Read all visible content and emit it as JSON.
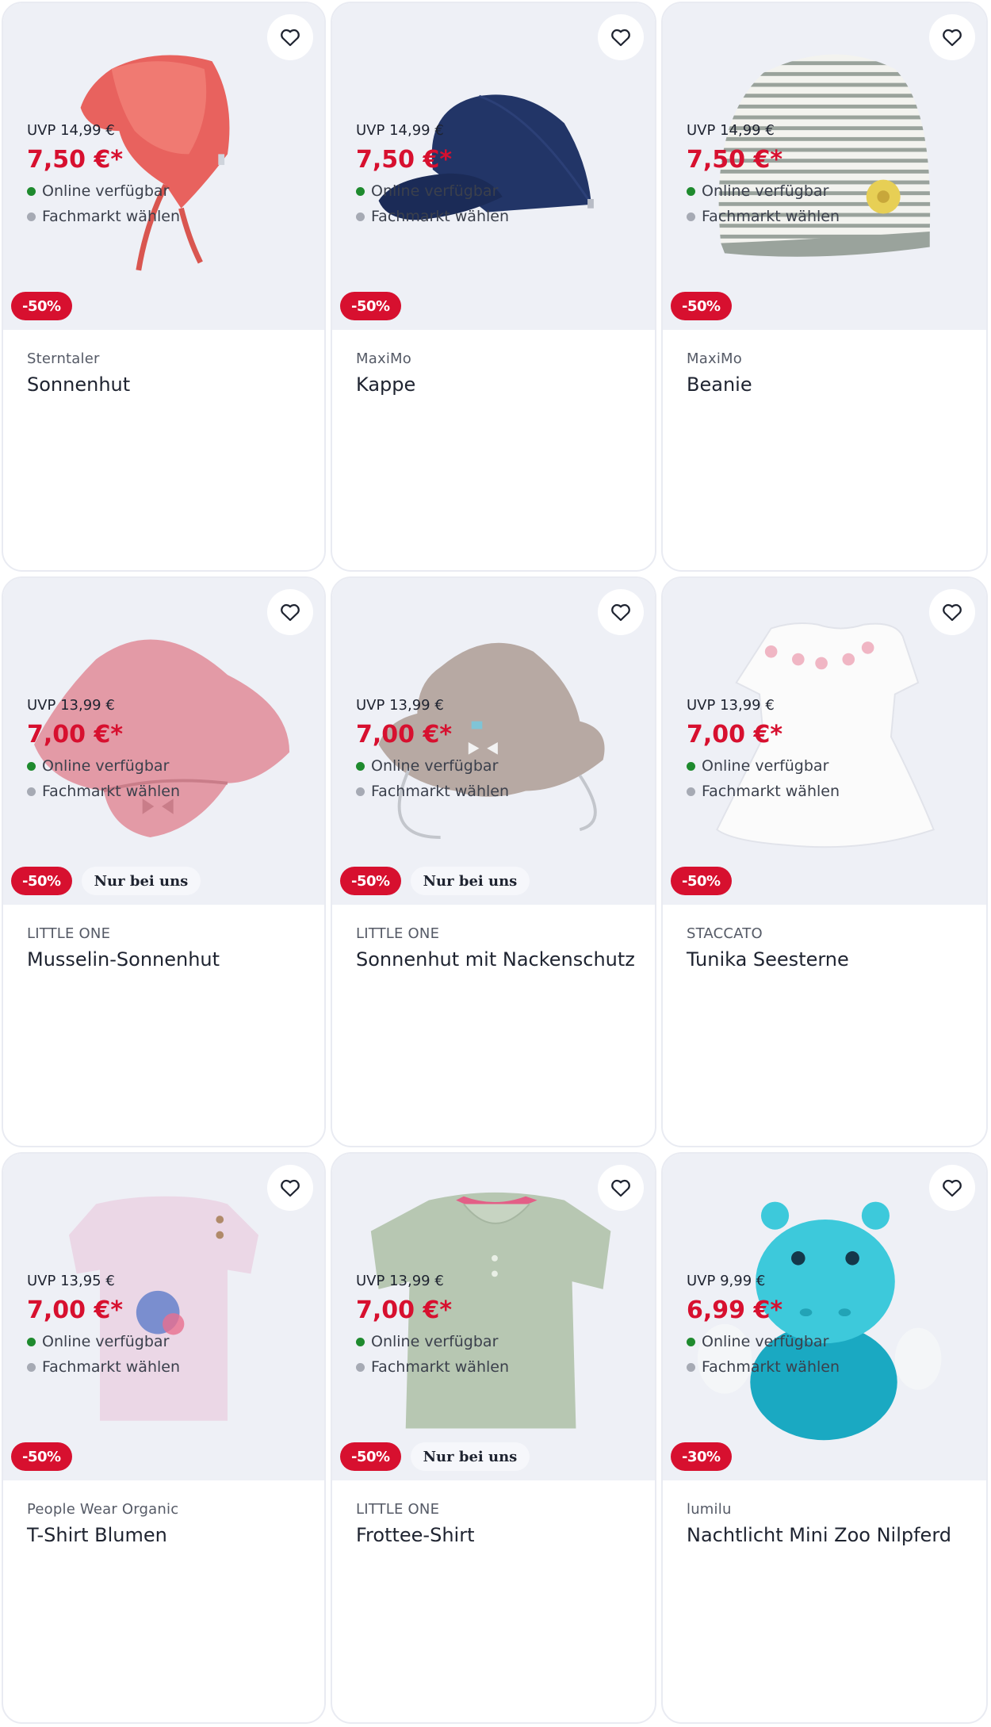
{
  "colors": {
    "discount_badge": "#d7102f",
    "price": "#d7102f",
    "online_dot": "#1e8a2e",
    "store_dot": "#a6aab4",
    "image_bg": "#eef0f6"
  },
  "products": [
    {
      "brand": "Sterntaler",
      "name": "Sonnenhut",
      "discount": "-50%",
      "exclusive": "",
      "uvp": "UVP 14,99 €",
      "price": "7,50 €*",
      "online": "Online verfügbar",
      "store": "Fachmarkt wählen",
      "image": "coral-sun-hat-illustration"
    },
    {
      "brand": "MaxiMo",
      "name": "Kappe",
      "discount": "-50%",
      "exclusive": "",
      "uvp": "UVP 14,99 €",
      "price": "7,50 €*",
      "online": "Online verfügbar",
      "store": "Fachmarkt wählen",
      "image": "navy-cap-illustration"
    },
    {
      "brand": "MaxiMo",
      "name": "Beanie",
      "discount": "-50%",
      "exclusive": "",
      "uvp": "UVP 14,99 €",
      "price": "7,50 €*",
      "online": "Online verfügbar",
      "store": "Fachmarkt wählen",
      "image": "striped-beanie-illustration"
    },
    {
      "brand": "LITTLE ONE",
      "name": "Musselin-Sonnenhut",
      "discount": "-50%",
      "exclusive": "Nur bei uns",
      "uvp": "UVP 13,99 €",
      "price": "7,00 €*",
      "online": "Online verfügbar",
      "store": "Fachmarkt wählen",
      "image": "pink-muslin-hat-illustration"
    },
    {
      "brand": "LITTLE ONE",
      "name": "Sonnenhut mit Nackenschutz",
      "discount": "-50%",
      "exclusive": "Nur bei uns",
      "uvp": "UVP 13,99 €",
      "price": "7,00 €*",
      "online": "Online verfügbar",
      "store": "Fachmarkt wählen",
      "image": "beige-neck-hat-illustration"
    },
    {
      "brand": "STACCATO",
      "name": "Tunika Seesterne",
      "discount": "-50%",
      "exclusive": "",
      "uvp": "UVP 13,99 €",
      "price": "7,00 €*",
      "online": "Online verfügbar",
      "store": "Fachmarkt wählen",
      "image": "white-tunic-illustration"
    },
    {
      "brand": "People Wear Organic",
      "name": "T-Shirt Blumen",
      "discount": "-50%",
      "exclusive": "",
      "uvp": "UVP 13,95 €",
      "price": "7,00 €*",
      "online": "Online verfügbar",
      "store": "Fachmarkt wählen",
      "image": "lilac-tshirt-illustration"
    },
    {
      "brand": "LITTLE ONE",
      "name": "Frottee-Shirt",
      "discount": "-50%",
      "exclusive": "Nur bei uns",
      "uvp": "UVP 13,99 €",
      "price": "7,00 €*",
      "online": "Online verfügbar",
      "store": "Fachmarkt wählen",
      "image": "green-polo-illustration"
    },
    {
      "brand": "lumilu",
      "name": "Nachtlicht Mini Zoo Nilpferd",
      "discount": "-30%",
      "exclusive": "",
      "uvp": "UVP 9,99 €",
      "price": "6,99 €*",
      "online": "Online verfügbar",
      "store": "Fachmarkt wählen",
      "image": "hippo-nightlight-illustration"
    }
  ]
}
